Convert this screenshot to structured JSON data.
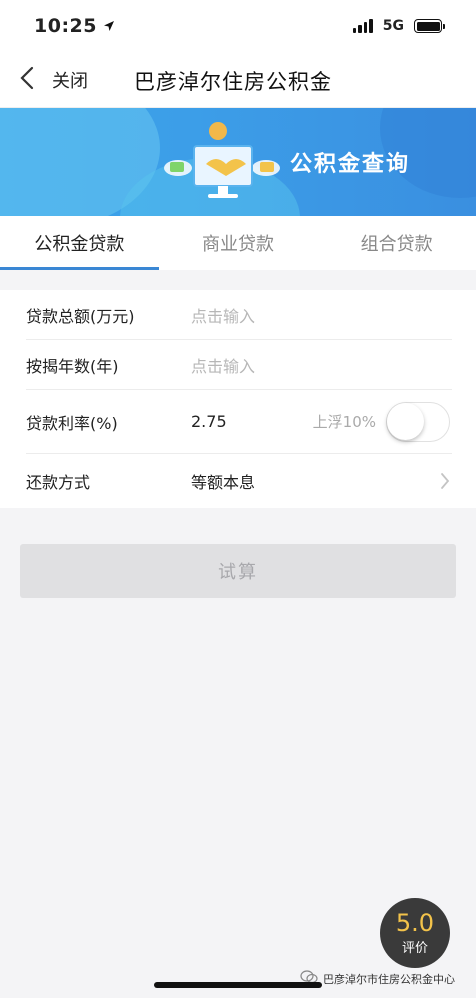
{
  "status": {
    "time": "10:25",
    "network": "5G"
  },
  "nav": {
    "close": "关闭",
    "title": "巴彦淖尔住房公积金"
  },
  "banner": {
    "title": "公积金查询"
  },
  "tabs": [
    {
      "label": "公积金贷款",
      "active": true
    },
    {
      "label": "商业贷款",
      "active": false
    },
    {
      "label": "组合贷款",
      "active": false
    }
  ],
  "form": {
    "loan_amount": {
      "label": "贷款总额(万元)",
      "placeholder": "点击输入"
    },
    "years": {
      "label": "按揭年数(年)",
      "placeholder": "点击输入"
    },
    "rate": {
      "label": "贷款利率(%)",
      "value": "2.75",
      "float_label": "上浮10%",
      "float_on": false
    },
    "repay": {
      "label": "还款方式",
      "value": "等额本息"
    }
  },
  "calc_button": "试算",
  "rating": {
    "score": "5.0",
    "label": "评价"
  },
  "watermark": "巴彦淖尔市住房公积金中心",
  "colors": {
    "accent": "#3a87d4",
    "banner": "#3a9ee8"
  }
}
